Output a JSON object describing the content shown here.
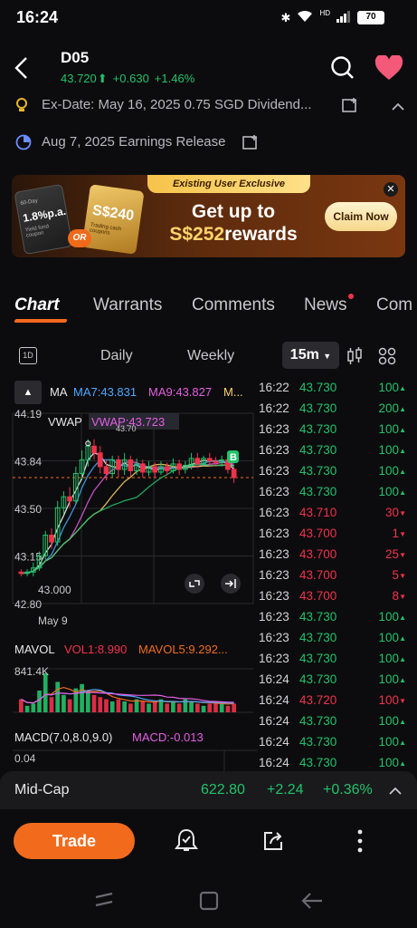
{
  "status": {
    "time": "16:24",
    "signal_label": "HD",
    "battery": "70"
  },
  "header": {
    "ticker": "D05",
    "price": "43.720",
    "change": "+0.630",
    "change_pct": "+1.46%"
  },
  "events": [
    {
      "text": "Ex-Date:  May 16, 2025 0.75 SGD Dividend..."
    },
    {
      "text": "Aug 7, 2025 Earnings Release"
    }
  ],
  "banner": {
    "tag": "Existing User Exclusive",
    "headline_1": "Get up to",
    "headline_2": "S$252",
    "headline_3": "rewards",
    "claim": "Claim Now",
    "card1_days": "60-Day",
    "card1_rate": "1.8%p.a.",
    "card1_sub": "Yield fund coupon",
    "card2_amount": "S$240",
    "card2_sub": "Trading cash coupons",
    "or": "OR"
  },
  "tabs": [
    "Chart",
    "Warrants",
    "Comments",
    "News",
    "Com"
  ],
  "periods": {
    "intraday_icon": "1D",
    "daily": "Daily",
    "weekly": "Weekly",
    "selected": "15m"
  },
  "indicators": {
    "ma": "MA",
    "ma7": "MA7:43.831",
    "ma9": "MA9:43.827",
    "ma_more": "M...",
    "vwap": "VWAP",
    "vwap_val": "VWAP:43.723",
    "mavol": "MAVOL",
    "vol1": "VOL1:8.990",
    "mavol5": "MAVOL5:9.292...",
    "macd": "MACD(7.0,8.0,9.0)",
    "macd_val": "MACD:-0.013"
  },
  "chart_data": {
    "type": "candlestick",
    "y_labels": [
      "44.19",
      "43.84",
      "43.50",
      "43.15",
      "42.80"
    ],
    "ylim": [
      42.8,
      44.19
    ],
    "low_label": "43.000",
    "high_marker": "43.70",
    "date_label": "May 9",
    "buy_marker": "B",
    "vol_label": "841.4K",
    "macd_label": "0.04",
    "last_price": 43.72,
    "candles": [
      [
        43.03,
        43.02,
        43.05,
        43.0
      ],
      [
        43.02,
        43.03,
        43.05,
        43.0
      ],
      [
        43.03,
        43.06,
        43.1,
        43.0
      ],
      [
        43.06,
        43.15,
        43.18,
        43.04
      ],
      [
        43.15,
        43.3,
        43.33,
        43.12
      ],
      [
        43.3,
        43.25,
        43.35,
        43.2
      ],
      [
        43.25,
        43.5,
        43.55,
        43.22
      ],
      [
        43.5,
        43.58,
        43.62,
        43.45
      ],
      [
        43.58,
        43.55,
        43.65,
        43.5
      ],
      [
        43.55,
        43.75,
        43.8,
        43.53
      ],
      [
        43.75,
        43.85,
        43.92,
        43.7
      ],
      [
        43.85,
        43.95,
        44.0,
        43.8
      ],
      [
        43.95,
        43.9,
        44.0,
        43.85
      ],
      [
        43.9,
        43.8,
        43.95,
        43.75
      ],
      [
        43.8,
        43.75,
        43.85,
        43.7
      ],
      [
        43.75,
        43.85,
        43.88,
        43.72
      ],
      [
        43.85,
        43.78,
        43.88,
        43.72
      ],
      [
        43.78,
        43.85,
        43.9,
        43.74
      ],
      [
        43.85,
        43.77,
        43.88,
        43.73
      ],
      [
        43.77,
        43.82,
        43.86,
        43.74
      ],
      [
        43.82,
        43.76,
        43.85,
        43.72
      ],
      [
        43.76,
        43.8,
        43.84,
        43.73
      ],
      [
        43.8,
        43.76,
        43.83,
        43.72
      ],
      [
        43.76,
        43.8,
        43.84,
        43.74
      ],
      [
        43.8,
        43.77,
        43.83,
        43.74
      ],
      [
        43.77,
        43.82,
        43.86,
        43.75
      ],
      [
        43.82,
        43.78,
        43.85,
        43.74
      ],
      [
        43.78,
        43.81,
        43.84,
        43.75
      ],
      [
        43.81,
        43.86,
        43.9,
        43.78
      ],
      [
        43.86,
        43.82,
        43.9,
        43.79
      ],
      [
        43.82,
        43.86,
        43.88,
        43.8
      ],
      [
        43.86,
        43.84,
        43.9,
        43.8
      ],
      [
        43.84,
        43.83,
        43.87,
        43.8
      ],
      [
        43.83,
        43.85,
        43.88,
        43.8
      ],
      [
        43.85,
        43.78,
        43.87,
        43.75
      ],
      [
        43.78,
        43.72,
        43.8,
        43.68
      ]
    ],
    "volumes": [
      0.3,
      0.15,
      0.2,
      0.5,
      0.9,
      0.35,
      0.7,
      0.4,
      0.3,
      0.55,
      0.65,
      0.5,
      0.4,
      0.35,
      0.3,
      0.25,
      0.3,
      0.25,
      0.2,
      0.3,
      0.25,
      0.2,
      0.25,
      0.3,
      0.2,
      0.25,
      0.2,
      0.3,
      0.25,
      0.2,
      0.15,
      0.2,
      0.25,
      0.2,
      0.15,
      0.2
    ]
  },
  "ticks": [
    {
      "time": "16:22",
      "price": "43.730",
      "vol": "100",
      "dir": "up"
    },
    {
      "time": "16:22",
      "price": "43.730",
      "vol": "200",
      "dir": "up"
    },
    {
      "time": "16:23",
      "price": "43.730",
      "vol": "100",
      "dir": "up"
    },
    {
      "time": "16:23",
      "price": "43.730",
      "vol": "100",
      "dir": "up"
    },
    {
      "time": "16:23",
      "price": "43.730",
      "vol": "100",
      "dir": "up"
    },
    {
      "time": "16:23",
      "price": "43.730",
      "vol": "100",
      "dir": "up"
    },
    {
      "time": "16:23",
      "price": "43.710",
      "vol": "30",
      "dir": "down"
    },
    {
      "time": "16:23",
      "price": "43.700",
      "vol": "1",
      "dir": "down"
    },
    {
      "time": "16:23",
      "price": "43.700",
      "vol": "25",
      "dir": "down"
    },
    {
      "time": "16:23",
      "price": "43.700",
      "vol": "5",
      "dir": "down"
    },
    {
      "time": "16:23",
      "price": "43.700",
      "vol": "8",
      "dir": "down"
    },
    {
      "time": "16:23",
      "price": "43.730",
      "vol": "100",
      "dir": "up"
    },
    {
      "time": "16:23",
      "price": "43.730",
      "vol": "100",
      "dir": "up"
    },
    {
      "time": "16:23",
      "price": "43.730",
      "vol": "100",
      "dir": "up"
    },
    {
      "time": "16:24",
      "price": "43.730",
      "vol": "100",
      "dir": "up"
    },
    {
      "time": "16:24",
      "price": "43.720",
      "vol": "100",
      "dir": "down"
    },
    {
      "time": "16:24",
      "price": "43.730",
      "vol": "100",
      "dir": "up"
    },
    {
      "time": "16:24",
      "price": "43.730",
      "vol": "100",
      "dir": "up"
    },
    {
      "time": "16:24",
      "price": "43.730",
      "vol": "100",
      "dir": "up"
    }
  ],
  "midcap": {
    "label": "Mid-Cap",
    "value": "622.80",
    "change": "+2.24",
    "change_pct": "+0.36%"
  },
  "bottom": {
    "trade": "Trade"
  },
  "colors": {
    "up": "#21c26b",
    "down": "#f0324b",
    "accent": "#f26b1d"
  }
}
